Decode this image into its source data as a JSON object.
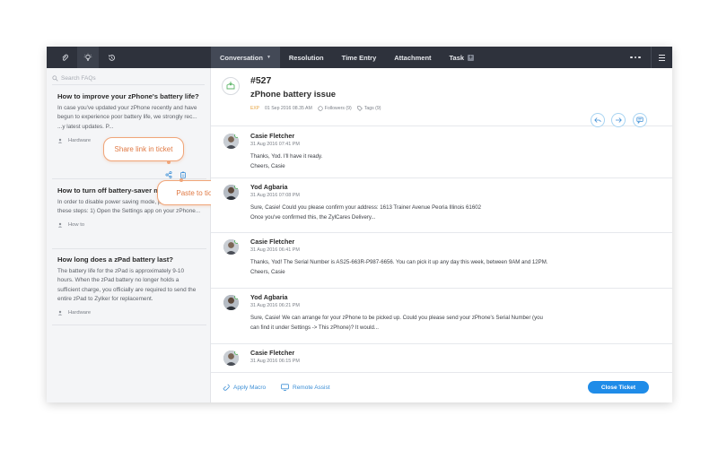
{
  "topbar": {
    "tabs": [
      {
        "label": "Conversation",
        "active": true
      },
      {
        "label": "Resolution"
      },
      {
        "label": "Time Entry"
      },
      {
        "label": "Attachment"
      },
      {
        "label": "Task"
      }
    ],
    "icons": [
      "paperclip-icon",
      "lightbulb-icon",
      "history-icon",
      "more-icon",
      "menu-icon"
    ]
  },
  "search": {
    "placeholder": "Search FAQs"
  },
  "faqs": [
    {
      "title": "How to improve your zPhone's battery life?",
      "body": "In case you've updated your zPhone recently and have begun to experience poor battery life, we strongly rec... ...y latest updates. P...",
      "category": "Hardware"
    },
    {
      "title": "How to turn off battery-saver mode?",
      "body": "In order to disable power saving mode, please follow these steps: 1) Open the Settings app on your zPhone...",
      "category": "How to"
    },
    {
      "title": "How long does a zPad battery last?",
      "body": "The battery life for the zPad is approximately 9-10 hours. When the zPad battery no longer holds a sufficient charge, you officially are required to send the entire zPad to Zylker for replacement.",
      "category": "Hardware"
    }
  ],
  "callouts": {
    "share": "Share link in ticket",
    "paste": "Paste to ticket"
  },
  "ticket": {
    "number": "#527",
    "subject": "zPhone battery issue",
    "tag": "EXP",
    "date": "01 Sep 2016 08.35 AM",
    "followers": "Followers (9)",
    "tags": "Tags (9)"
  },
  "messages": [
    {
      "name": "Casie Fletcher",
      "time": "31 Aug 2016 07:41 PM",
      "lines": [
        "Thanks, Yod. I'll have it ready.",
        "Cheers, Casie"
      ]
    },
    {
      "name": "Yod Agbaria",
      "time": "31 Aug 2016 07:08 PM",
      "lines": [
        "Sure, Casie! Could you please confirm your address: 1613 Trainer Avenue Peoria Illinois 61602",
        "Once you've confirmed this, the ZylCares Delivery..."
      ]
    },
    {
      "name": "Casie Fletcher",
      "time": "31 Aug 2016 06:41 PM",
      "lines": [
        "Thanks, Yod! The Serial Number is AS25-663R-P987-6656. You can pick it up any day this week, between 9AM and 12PM.",
        "Cheers, Casie"
      ]
    },
    {
      "name": "Yod Agbaria",
      "time": "31 Aug 2016 06:21 PM",
      "lines": [
        "Sure, Casie! We can arrange for your zPhone to be picked up. Could you please send your zPhone's Serial Number (you",
        "can find it under Settings -> This zPhone)? It would..."
      ]
    },
    {
      "name": "Casie Fletcher",
      "time": "31 Aug 2016 06:15 PM",
      "lines": []
    }
  ],
  "footer": {
    "apply_macro": "Apply Macro",
    "remote_assist": "Remote Assist",
    "close_ticket": "Close Ticket"
  },
  "colors": {
    "topbar": "#2e323c",
    "accent": "#1f8ce8",
    "callout": "#e07a45",
    "online": "#5fb56a"
  }
}
